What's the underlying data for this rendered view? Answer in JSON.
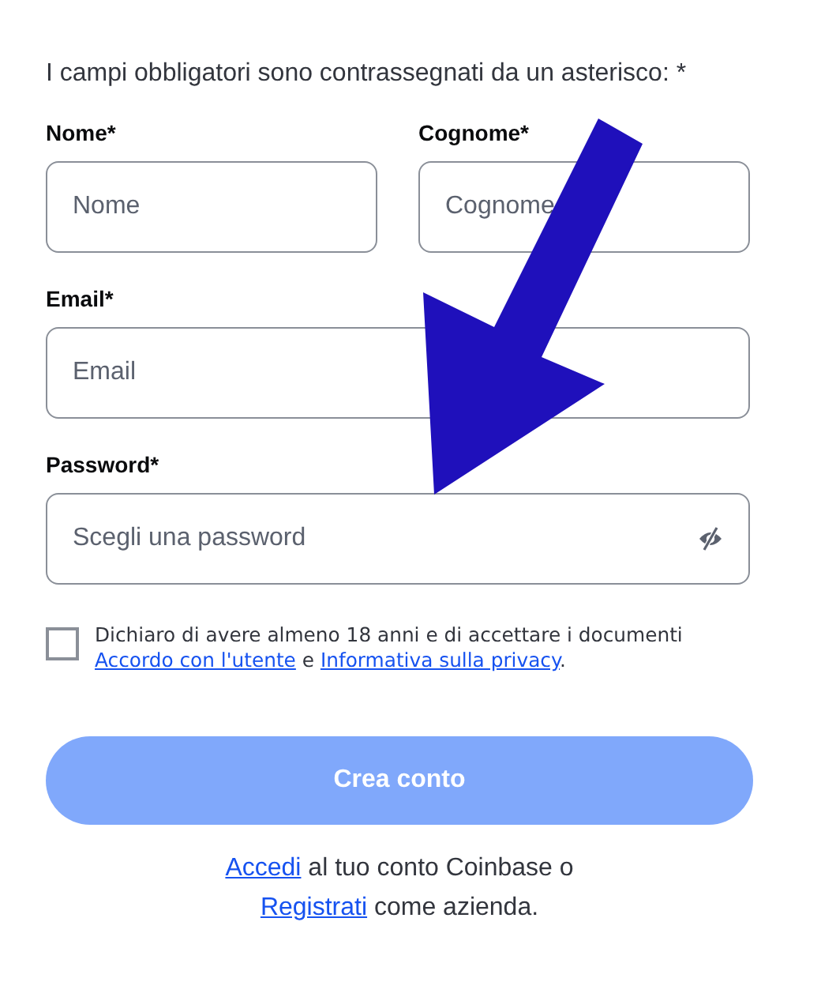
{
  "intro": "I campi obbligatori sono contrassegnati da un asterisco: *",
  "fields": [
    {
      "label": "Nome*",
      "placeholder": "Nome",
      "half": true
    },
    {
      "label": "Cognome*",
      "placeholder": "Cognome",
      "half": true
    },
    {
      "label": "Email*",
      "placeholder": "Email",
      "half": false
    },
    {
      "label": "Password*",
      "placeholder": "Scegli una password",
      "half": false,
      "kind": "password"
    }
  ],
  "consent": {
    "checked": false,
    "text": "Dichiaro di avere almeno 18 anni e di accettare i documenti",
    "link_1": "Accordo con l'utente",
    "joiner": "e",
    "link_2": "Informativa sulla privacy",
    "end": "."
  },
  "submit": {
    "label": "Crea conto",
    "disabled": true
  },
  "footer": [
    {
      "link": "Accedi",
      "text": "al tuo conto Coinbase o"
    },
    {
      "link": "Registrati",
      "text": "come azienda."
    }
  ],
  "annotation": {
    "kind": "arrow"
  }
}
